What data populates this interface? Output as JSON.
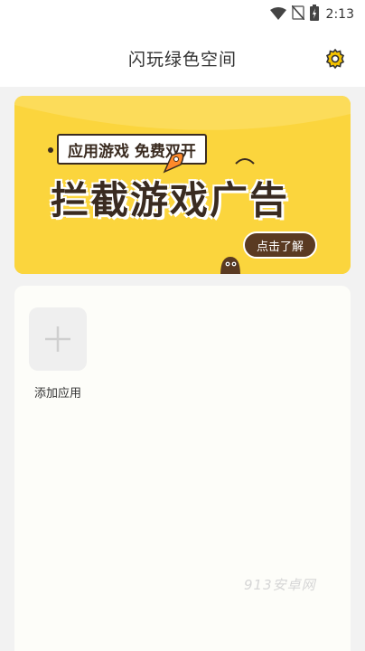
{
  "status_bar": {
    "time": "2:13",
    "icons": [
      "wifi-icon",
      "sim-off-icon",
      "battery-charging-icon"
    ]
  },
  "header": {
    "title": "闪玩绿色空间",
    "settings_icon": "gear-icon"
  },
  "banner": {
    "tag": "应用游戏 免费双开",
    "headline": "拦截游戏广告",
    "cta": "点击了解",
    "colors": {
      "background": "#fbd53d",
      "ink": "#3a2b20",
      "cta_bg": "#5a3a22"
    }
  },
  "apps": {
    "add_label": "添加应用",
    "add_icon": "plus-icon"
  },
  "watermark": "913安卓网"
}
